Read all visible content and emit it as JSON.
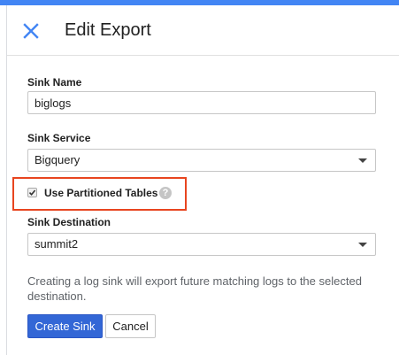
{
  "header": {
    "title": "Edit Export"
  },
  "form": {
    "sink_name": {
      "label": "Sink Name",
      "value": "biglogs"
    },
    "sink_service": {
      "label": "Sink Service",
      "selected": "Bigquery"
    },
    "partitioned": {
      "label": "Use Partitioned Tables",
      "checked": true,
      "help_glyph": "?"
    },
    "sink_destination": {
      "label": "Sink Destination",
      "selected": "summit2"
    },
    "info": "Creating a log sink will export future matching logs to the selected destination."
  },
  "actions": {
    "create_label": "Create Sink",
    "cancel_label": "Cancel"
  },
  "colors": {
    "accent": "#4285f4",
    "primary_button": "#3367d6",
    "highlight": "#e8451f"
  },
  "icons": {
    "close": "close-icon",
    "help": "help-icon",
    "dropdown": "chevron-down-icon",
    "checkbox": "check-icon"
  }
}
